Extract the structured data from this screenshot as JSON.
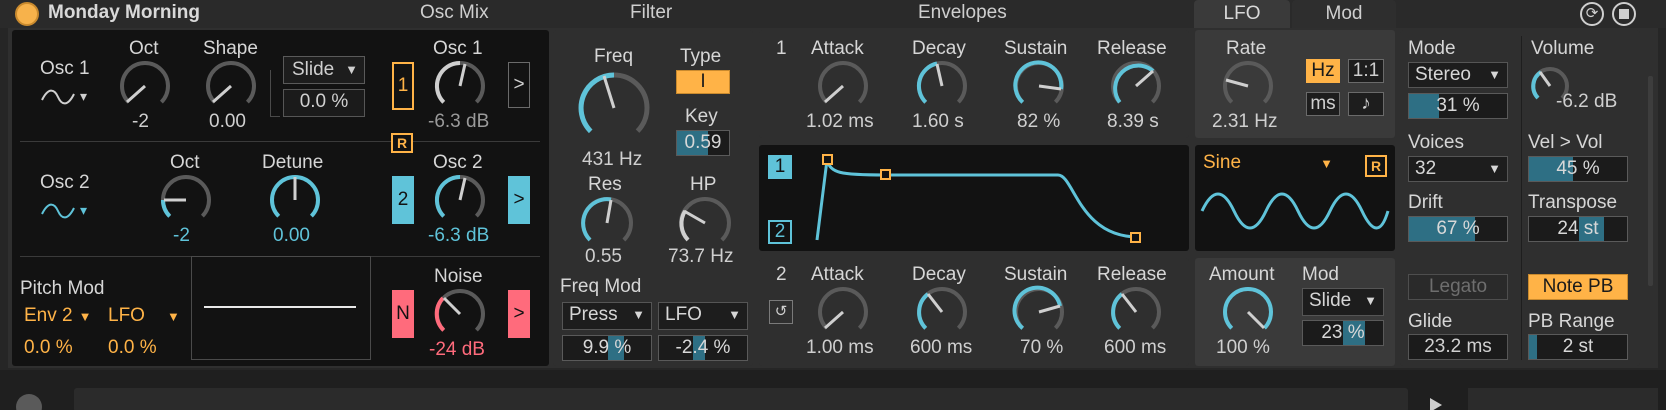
{
  "title": "Monday Morning",
  "sections": {
    "osc_mix": "Osc Mix",
    "filter": "Filter",
    "envelopes": "Envelopes",
    "lfo_tab": "LFO",
    "mod_tab": "Mod"
  },
  "osc1": {
    "label": "Osc 1",
    "wave_arrow": "▾",
    "oct_label": "Oct",
    "oct_value": "-2",
    "shape_label": "Shape",
    "shape_value": "0.00",
    "slide_label": "Slide",
    "slide_value": "0.0 %",
    "mix_label": "Osc 1",
    "mix_value": "-6.3 dB",
    "num": "1",
    "arrow": ">"
  },
  "osc2": {
    "label": "Osc 2",
    "wave_arrow": "▾",
    "oct_label": "Oct",
    "oct_value": "-2",
    "detune_label": "Detune",
    "detune_value": "0.00",
    "mix_label": "Osc 2",
    "mix_value": "-6.3 dB",
    "num": "2",
    "arrow": ">"
  },
  "retrigger_label": "R",
  "pitch_mod": {
    "label": "Pitch Mod",
    "source1": "Env 2",
    "source2": "LFO",
    "amount1": "0.0 %",
    "amount2": "0.0 %"
  },
  "noise": {
    "label": "Noise",
    "value": "-24 dB",
    "n_label": "N",
    "arrow": ">"
  },
  "filter": {
    "freq_label": "Freq",
    "freq_value": "431 Hz",
    "type_label": "Type",
    "type_value": "I",
    "key_label": "Key",
    "key_value": "0.59",
    "key_amount": 0.59,
    "res_label": "Res",
    "res_value": "0.55",
    "hp_label": "HP",
    "hp_value": "73.7 Hz",
    "freq_mod_label": "Freq Mod",
    "mod_source1": "Press",
    "mod_source2": "LFO",
    "mod_amount1": "9.9 %",
    "mod_amount2": "-2.4 %",
    "mod_amount1_level": 0.099,
    "mod_amount2_level": -0.024
  },
  "env1": {
    "num": "1",
    "attack_label": "Attack",
    "attack_value": "1.02 ms",
    "decay_label": "Decay",
    "decay_value": "1.60 s",
    "sustain_label": "Sustain",
    "sustain_value": "82 %",
    "release_label": "Release",
    "release_value": "8.39 s"
  },
  "env_display": {
    "sel1": "1",
    "sel2": "2"
  },
  "env2": {
    "num": "2",
    "attack_label": "Attack",
    "attack_value": "1.00 ms",
    "decay_label": "Decay",
    "decay_value": "600 ms",
    "sustain_label": "Sustain",
    "sustain_value": "70 %",
    "release_label": "Release",
    "release_value": "600 ms"
  },
  "lfo": {
    "rate_label": "Rate",
    "rate_value": "2.31 Hz",
    "hz_label": "Hz",
    "ratio_label": "1:1",
    "ms_label": "ms",
    "note_label": "♪",
    "wave": "Sine",
    "retrig": "R",
    "amount_label": "Amount",
    "amount_value": "100 %",
    "mod_label": "Mod",
    "mod_source": "Slide",
    "mod_amount": "23 %",
    "mod_amount_level": 0.23
  },
  "global": {
    "mode_label": "Mode",
    "mode_value": "Stereo",
    "mode_amount": "31 %",
    "mode_amount_level": 0.31,
    "volume_label": "Volume",
    "volume_value": "-6.2 dB",
    "voices_label": "Voices",
    "voices_value": "32",
    "vel_label": "Vel > Vol",
    "vel_value": "45 %",
    "vel_level": 0.45,
    "drift_label": "Drift",
    "drift_value": "67 %",
    "drift_level": 0.67,
    "transpose_label": "Transpose",
    "transpose_value": "24 st",
    "transpose_level": 0.5,
    "legato_label": "Legato",
    "note_pb_label": "Note PB",
    "glide_label": "Glide",
    "glide_value": "23.2 ms",
    "pb_range_label": "PB Range",
    "pb_range_value": "2 st",
    "pb_range_level": 0.08
  },
  "colors": {
    "accent_cyan": "#5fc3d9",
    "accent_orange": "#ffb347",
    "accent_pink": "#ff6b7c",
    "panel_dark": "#121212",
    "panel_mid": "#2f2f2f"
  }
}
